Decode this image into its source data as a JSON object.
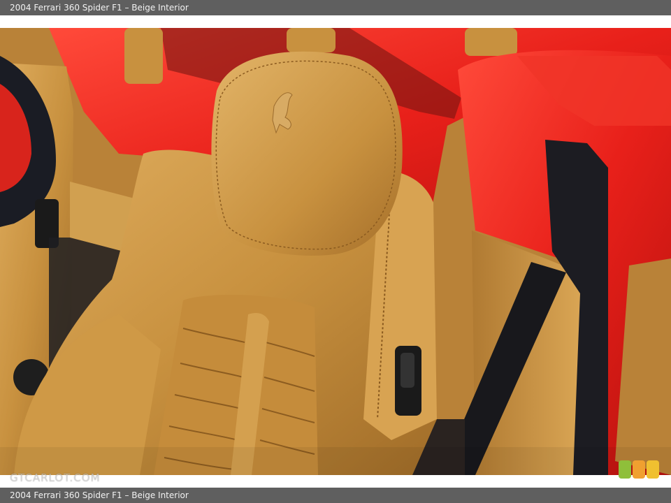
{
  "caption": {
    "top": "2004 Ferrari 360 Spider F1 – Beige Interior",
    "bottom": "2004 Ferrari 360 Spider F1 – Beige Interior"
  },
  "watermark": {
    "text": "GTCARLOT.COM"
  },
  "badge_colors": [
    "#8fbf3a",
    "#f0a030",
    "#f0c030"
  ],
  "colors": {
    "leather": "#c8913f",
    "body_red": "#e8201a",
    "caption_bar": "#5f5f5f"
  }
}
